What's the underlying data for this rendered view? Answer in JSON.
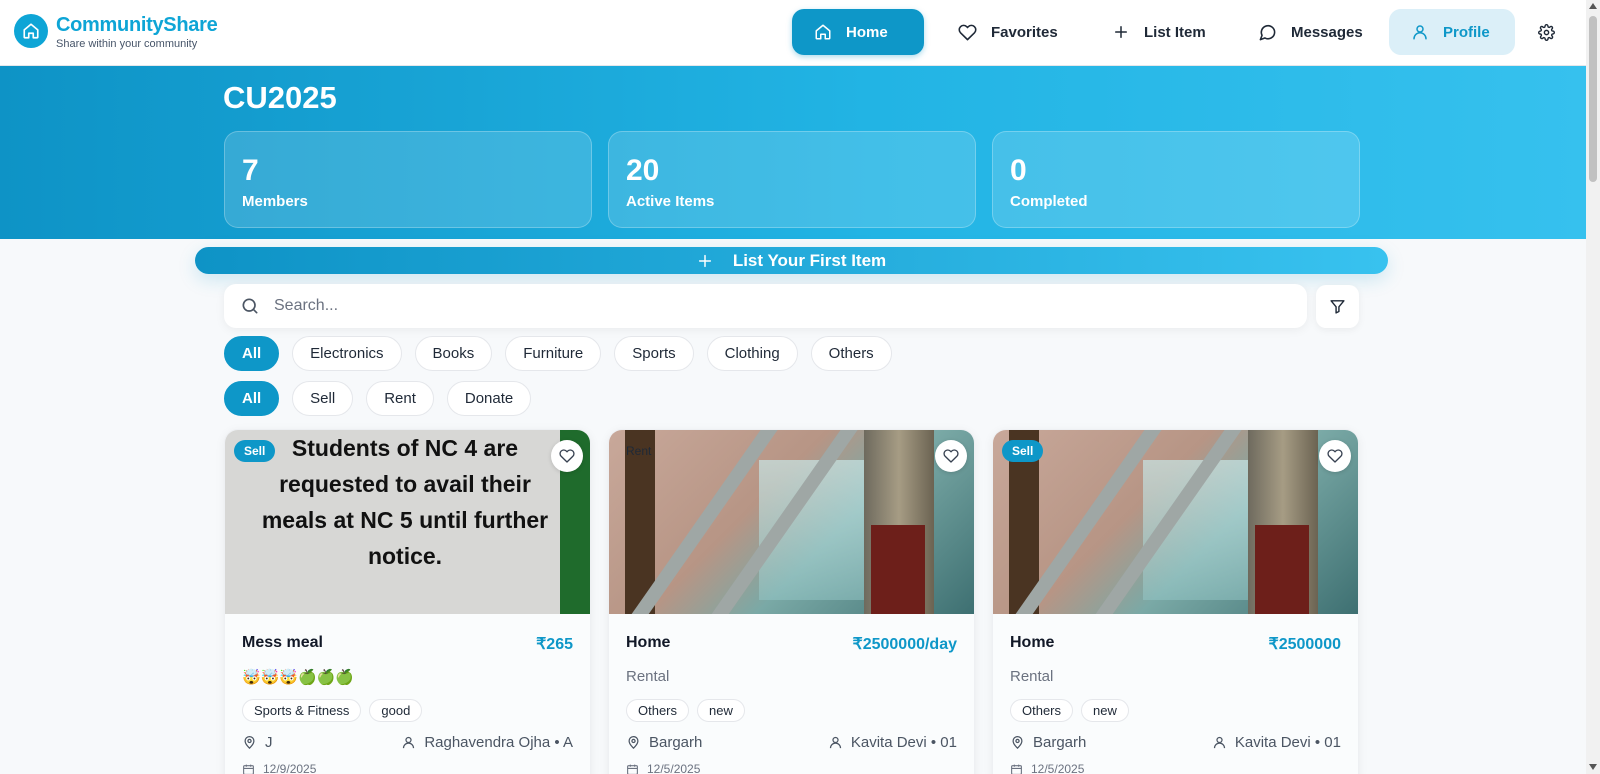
{
  "app": {
    "name": "CommunityShare",
    "tagline": "Share within your community",
    "icon": "home-icon"
  },
  "nav": {
    "home": "Home",
    "favorites": "Favorites",
    "list_item": "List Item",
    "messages": "Messages",
    "profile": "Profile",
    "active": "home"
  },
  "hero": {
    "title": "CU2025",
    "stats": [
      {
        "value": "7",
        "label": "Members"
      },
      {
        "value": "20",
        "label": "Active Items"
      },
      {
        "value": "0",
        "label": "Completed"
      }
    ]
  },
  "cta": {
    "label": "List Your First Item"
  },
  "search": {
    "placeholder": "Search..."
  },
  "categories": [
    "All",
    "Electronics",
    "Books",
    "Furniture",
    "Sports",
    "Clothing",
    "Others"
  ],
  "types": [
    "All",
    "Sell",
    "Rent",
    "Donate"
  ],
  "cards": [
    {
      "badge": "Sell",
      "image_text": "Students of NC 4 are requested to avail their meals at NC 5 until further notice.",
      "title": "Mess meal",
      "price": "₹265",
      "subtitle": "🤯🤯🤯🍏🍏🍏",
      "tags": [
        "Sports & Fitness",
        "good"
      ],
      "location": "J",
      "owner": "Raghavendra Ojha • A",
      "date": "12/9/2025"
    },
    {
      "badge": "Rent",
      "title": "Home",
      "price": "₹2500000/day",
      "subtitle": "Rental",
      "tags": [
        "Others",
        "new"
      ],
      "location": "Bargarh",
      "owner": "Kavita Devi • 01",
      "date": "12/5/2025"
    },
    {
      "badge": "Sell",
      "title": "Home",
      "price": "₹2500000",
      "subtitle": "Rental",
      "tags": [
        "Others",
        "new"
      ],
      "location": "Bargarh",
      "owner": "Kavita Devi • 01",
      "date": "12/5/2025"
    }
  ],
  "colors": {
    "accent": "#0e97c8",
    "hero_start": "#0e93c6",
    "hero_end": "#36c1ee"
  }
}
